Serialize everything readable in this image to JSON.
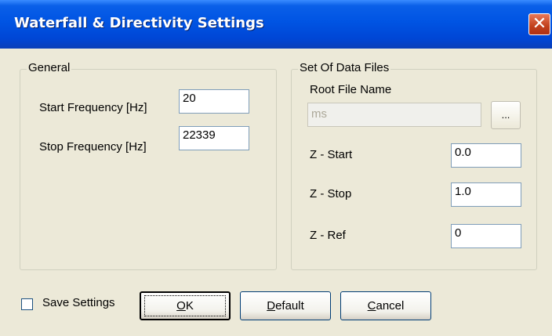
{
  "window": {
    "title": "Waterfall & Directivity Settings",
    "close_glyph": "✕"
  },
  "general": {
    "legend": "General",
    "start_label": "Start Frequency [Hz]",
    "start_value": "20",
    "stop_label": "Stop Frequency [Hz]",
    "stop_value": "22339"
  },
  "data_files": {
    "legend": "Set Of Data Files",
    "root_label": "Root File Name",
    "root_value": "ms",
    "browse_label": "...",
    "z_start_label": "Z - Start",
    "z_start_value": "0.0",
    "z_stop_label": "Z - Stop",
    "z_stop_value": "1.0",
    "z_ref_label": "Z - Ref",
    "z_ref_value": "0"
  },
  "footer": {
    "save_settings_label": "Save Settings",
    "save_settings_checked": false,
    "ok_mnemonic": "O",
    "ok_rest": "K",
    "default_mnemonic": "D",
    "default_rest": "efault",
    "cancel_mnemonic": "C",
    "cancel_rest": "ancel"
  }
}
